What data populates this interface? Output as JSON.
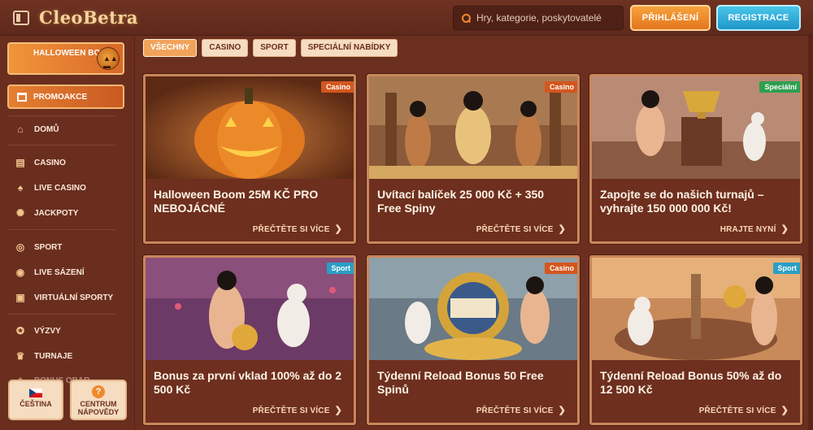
{
  "header": {
    "logo": "CleoBetra",
    "search_placeholder": "Hry, kategorie, poskytovatelé",
    "login_label": "PŘIHLÁŠENÍ",
    "register_label": "REGISTRACE"
  },
  "sidebar": {
    "promo_banner": "HALLOWEEN BOOM",
    "promo_button": "PROMOAKCE",
    "items": [
      {
        "label": "DOMŮ",
        "icon": "home-icon"
      },
      {
        "label": "CASINO",
        "icon": "slot-icon"
      },
      {
        "label": "LIVE CASINO",
        "icon": "cards-icon"
      },
      {
        "label": "JACKPOTY",
        "icon": "jackpot-icon"
      },
      {
        "label": "SPORT",
        "icon": "ball-icon"
      },
      {
        "label": "LIVE SÁZENÍ",
        "icon": "live-bet-icon"
      },
      {
        "label": "VIRTUÁLNÍ SPORTY",
        "icon": "virtual-sport-icon"
      },
      {
        "label": "VÝZVY",
        "icon": "challenge-icon"
      },
      {
        "label": "TURNAJE",
        "icon": "trophy-icon"
      },
      {
        "label": "BONUS OBAR",
        "icon": "bonus-icon"
      }
    ],
    "language_label": "ČEŠTINA",
    "help_label": "CENTRUM NÁPOVĚDY"
  },
  "filters": [
    "VŠECHNY",
    "CASINO",
    "SPORT",
    "SPECIÁLNÍ NABÍDKY"
  ],
  "cards": [
    {
      "tag": "Casino",
      "tag_color": "#d4561e",
      "title": "Halloween Boom 25M KČ PRO NEBOJÁCNÉ",
      "cta": "PŘEČTĚTE SI VÍCE"
    },
    {
      "tag": "Casino",
      "tag_color": "#d4561e",
      "title": "Uvítací balíček 25 000 Kč + 350 Free Spiny",
      "cta": "PŘEČTĚTE SI VÍCE"
    },
    {
      "tag": "Speciální",
      "tag_color": "#2e9e4f",
      "title": "Zapojte se do našich turnajů – vyhrajte 150 000 000 Kč!",
      "cta": "HRAJTE NYNÍ"
    },
    {
      "tag": "Sport",
      "tag_color": "#2a9fc4",
      "title": "Bonus za první vklad 100% až do 2 500 Kč",
      "cta": "PŘEČTĚTE SI VÍCE"
    },
    {
      "tag": "Casino",
      "tag_color": "#d4561e",
      "title": "Týdenní Reload Bonus 50 Free Spinů",
      "cta": "PŘEČTĚTE SI VÍCE"
    },
    {
      "tag": "Sport",
      "tag_color": "#2a9fc4",
      "title": "Týdenní Reload Bonus 50% až do 12 500 Kč",
      "cta": "PŘEČTĚTE SI VÍCE"
    }
  ]
}
